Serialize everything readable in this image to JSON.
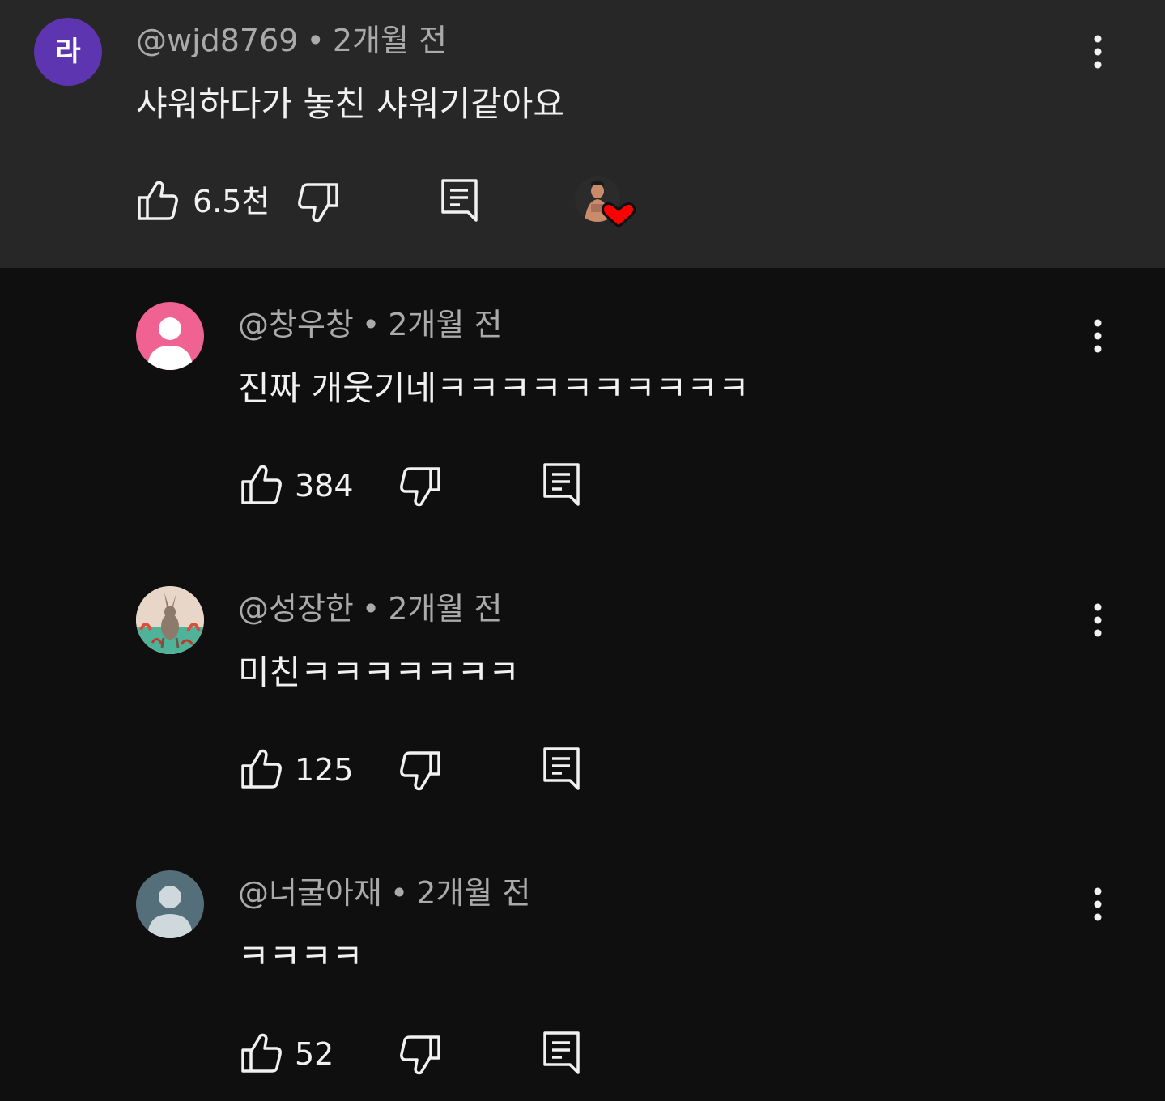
{
  "comments": [
    {
      "handle": "@wjd8769",
      "time": "2개월 전",
      "text": "샤워하다가 놓친 샤워기같아요",
      "likes": "6.5천",
      "avatar_letter": "라",
      "avatar_color": "#5e35b1",
      "creator_heart": true
    },
    {
      "handle": "@창우창",
      "time": "2개월 전",
      "text": "진짜 개웃기네ㅋㅋㅋㅋㅋㅋㅋㅋㅋㅋ",
      "likes": "384",
      "avatar_color": "#f06292"
    },
    {
      "handle": "@성장한",
      "time": "2개월 전",
      "text": "미친ㅋㅋㅋㅋㅋㅋㅋ",
      "likes": "125",
      "avatar_color": "#b2dfdb"
    },
    {
      "handle": "@너굴아재",
      "time": "2개월 전",
      "text": "ㅋㅋㅋㅋ",
      "likes": "52",
      "avatar_color": "#546e7a"
    }
  ],
  "separator": "•",
  "colors": {
    "background": "#0f0f0f",
    "highlight_background": "#272727",
    "heart": "#ff0000"
  }
}
